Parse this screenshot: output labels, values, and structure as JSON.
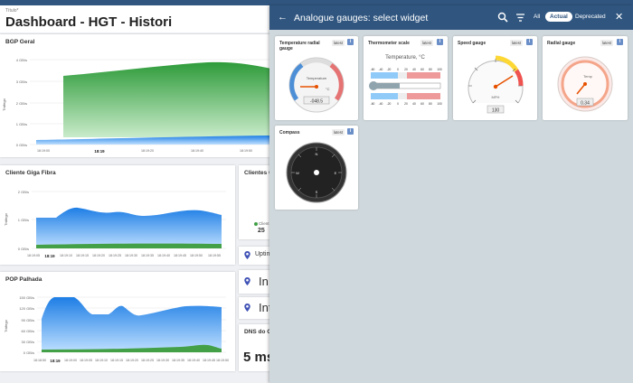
{
  "header": {
    "small_label": "Título*",
    "title": "Dashboard - HGT - Histori"
  },
  "bgp": {
    "title": "BGP Geral",
    "y_axis_title": "Tráfego",
    "y_ticks": [
      "4 GB/s",
      "3 GB/s",
      "2 GB/s",
      "1 GB/s",
      "0 GB/s"
    ],
    "x_ticks": [
      "18:19:00",
      "18:19",
      "18:19:20",
      "18:19:40",
      "18:19:50"
    ],
    "colors": {
      "green": "#43a047",
      "blue": "#1e88e5"
    }
  },
  "giga": {
    "title": "Cliente Giga Fibra",
    "y_axis_title": "Tráfego",
    "y_ticks": [
      "2 GB/s",
      "1 GB/s",
      "0 GB/s"
    ],
    "x_ticks": [
      "18:19:05",
      "18:19",
      "18:19:10",
      "18:19:15",
      "18:19:20",
      "18:19:25",
      "18:19:30",
      "18:19:35",
      "18:19:40",
      "18:19:45",
      "18:19:50",
      "18:19:55"
    ]
  },
  "pop": {
    "title": "POP Palhada",
    "y_axis_title": "Tráfego",
    "y_ticks": [
      "150 GB/s",
      "120 GB/s",
      "90 GB/s",
      "60 GB/s",
      "30 GB/s",
      "0 GB/s"
    ],
    "x_ticks": [
      "18:18:50",
      "18:19",
      "18:19:00",
      "18:19:05",
      "18:19:10",
      "18:19:15",
      "18:19:20",
      "18:19:25",
      "18:19:30",
      "18:19:35",
      "18:19:40",
      "18:19:45",
      "18:19:50"
    ]
  },
  "clientes": {
    "title": "Clientes C",
    "legend": "Client",
    "value": "25"
  },
  "uptime": {
    "label": "Uptim"
  },
  "card_in": {
    "label": "In"
  },
  "card_int": {
    "label": "Int"
  },
  "dns": {
    "title": "DNS do G",
    "value": "5 ms"
  },
  "overlay": {
    "title": "Analogue gauges: select widget",
    "tabs": [
      "All",
      "Actual",
      "Deprecated"
    ],
    "active_tab": "Actual",
    "widgets": [
      {
        "title": "Temperature radial gauge",
        "badge": "latest",
        "unit": "°C",
        "name": "Temperature",
        "reading": "-048.5"
      },
      {
        "title": "Thermometer scale",
        "badge": "latest",
        "label": "Temperature, °C",
        "ticks": [
          "-60",
          "-40",
          "-20",
          "0",
          "20",
          "40",
          "60",
          "80",
          "100"
        ]
      },
      {
        "title": "Speed gauge",
        "badge": "latest",
        "unit": "MPH",
        "reading": "130"
      },
      {
        "title": "Radial gauge",
        "badge": "latest",
        "name": "Temp",
        "reading": "0.34"
      },
      {
        "title": "Compass",
        "badge": "latest",
        "letters": [
          "N",
          "E",
          "S",
          "W"
        ]
      }
    ]
  }
}
